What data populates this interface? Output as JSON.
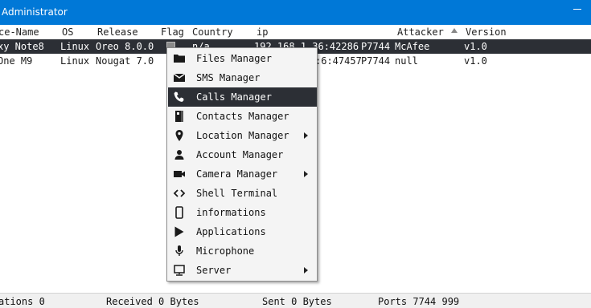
{
  "window": {
    "title": "Administrator"
  },
  "table": {
    "columns": [
      "ce-Name",
      "OS",
      "Release",
      "Flag",
      "Country",
      "ip",
      "Attacker",
      "Version"
    ],
    "rows": [
      {
        "name": "xy Note8",
        "os": "Linux",
        "release": "Oreo 8.0.0",
        "country": "n/a",
        "ip": "192.168.1.36:42286",
        "port": "P7744",
        "attacker": "McAfee",
        "version": "v1.0"
      },
      {
        "name": "One M9",
        "os": "Linux",
        "release": "Nougat 7.0",
        "country": "",
        "ip": ":6:47457",
        "port": "P7744",
        "attacker": "null",
        "version": "v1.0"
      }
    ]
  },
  "context_menu": {
    "items": [
      {
        "label": "Files Manager",
        "icon": "folder-icon",
        "submenu": false
      },
      {
        "label": "SMS Manager",
        "icon": "envelope-icon",
        "submenu": false
      },
      {
        "label": "Calls Manager",
        "icon": "phone-icon",
        "submenu": false
      },
      {
        "label": "Contacts Manager",
        "icon": "contacts-book-icon",
        "submenu": false
      },
      {
        "label": "Location Manager",
        "icon": "map-pin-icon",
        "submenu": true
      },
      {
        "label": "Account Manager",
        "icon": "user-icon",
        "submenu": false
      },
      {
        "label": "Camera Manager",
        "icon": "video-camera-icon",
        "submenu": true
      },
      {
        "label": "Shell Terminal",
        "icon": "code-brackets-icon",
        "submenu": false
      },
      {
        "label": "informations",
        "icon": "smartphone-icon",
        "submenu": false
      },
      {
        "label": "Applications",
        "icon": "play-store-icon",
        "submenu": false
      },
      {
        "label": "Microphone",
        "icon": "microphone-icon",
        "submenu": false
      },
      {
        "label": "Server",
        "icon": "computer-icon",
        "submenu": true
      }
    ],
    "highlighted": "Calls Manager"
  },
  "status": {
    "connections": "ations 0",
    "received": "Received 0 Bytes",
    "sent": "Sent 0 Bytes",
    "ports": "Ports 7744 999"
  },
  "colors": {
    "titlebar": "#0078d7",
    "selection": "#2c2f35",
    "menu_bg": "#f4f4f4"
  }
}
